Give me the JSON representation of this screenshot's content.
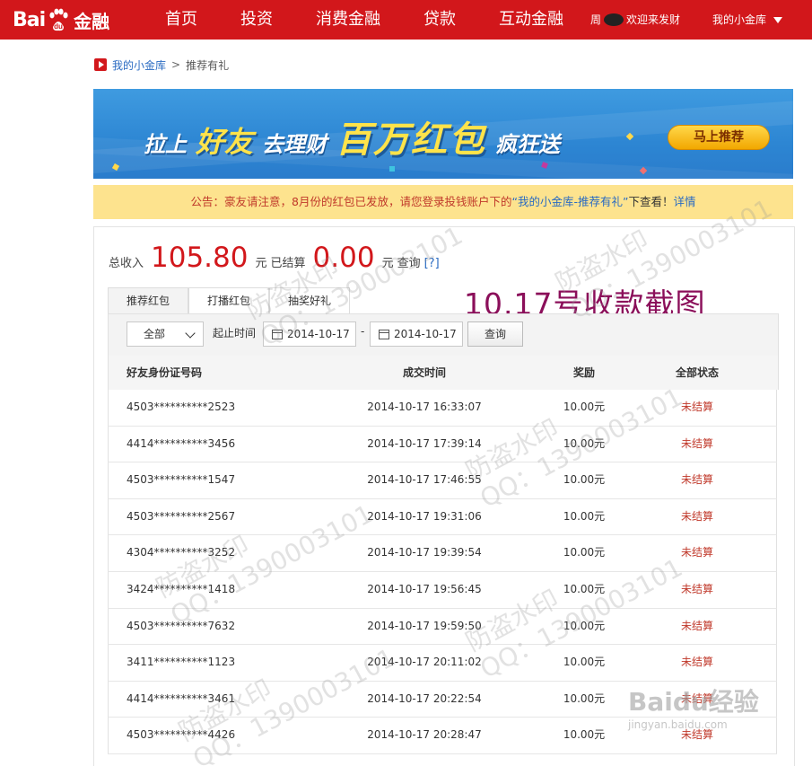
{
  "header": {
    "logo_bai": "Bai",
    "logo_du": "du",
    "logo_jr": "金融",
    "nav": [
      "首页",
      "投资",
      "消费金融",
      "贷款",
      "互动金融"
    ],
    "greeting_prefix": "周",
    "greeting_suffix": "欢迎来发财",
    "my_vault": "我的小金库"
  },
  "breadcrumb": {
    "home": "我的小金库",
    "sep": ">",
    "current": "推荐有礼"
  },
  "banner": {
    "t1": "拉上",
    "t2": "好友",
    "t3": "去理财",
    "t4": "百万红包",
    "t5": "疯狂送",
    "button": "马上推荐"
  },
  "notice": {
    "prefix": "公告：豪友请注意，8月份的红包已发放，请您登录投钱账户下的",
    "quote": "“我的小金库-推荐有礼”",
    "mid": "下查看！",
    "link": "详情"
  },
  "summary": {
    "total_label": "总收入",
    "total_value": "105.80",
    "unit1": "元",
    "settled_label": "已结算",
    "settled_value": "0.00",
    "unit2": "元",
    "query": "查询",
    "help": "[?]"
  },
  "overlay_title": "10.17号收款截图",
  "tabs": [
    "推荐红包",
    "打播红包",
    "抽奖好礼"
  ],
  "filter": {
    "select_value": "全部",
    "range_label": "起止时间",
    "start_date": "2014-10-17",
    "dash": "-",
    "end_date": "2014-10-17",
    "query_button": "查询"
  },
  "table": {
    "headers": [
      "好友身份证号码",
      "成交时间",
      "奖励",
      "全部状态"
    ],
    "rows": [
      {
        "id": "4503**********2523",
        "time": "2014-10-17 16:33:07",
        "amount": "10.00元",
        "status": "未结算"
      },
      {
        "id": "4414**********3456",
        "time": "2014-10-17 17:39:14",
        "amount": "10.00元",
        "status": "未结算"
      },
      {
        "id": "4503**********1547",
        "time": "2014-10-17 17:46:55",
        "amount": "10.00元",
        "status": "未结算"
      },
      {
        "id": "4503**********2567",
        "time": "2014-10-17 19:31:06",
        "amount": "10.00元",
        "status": "未结算"
      },
      {
        "id": "4304**********3252",
        "time": "2014-10-17 19:39:54",
        "amount": "10.00元",
        "status": "未结算"
      },
      {
        "id": "3424**********1418",
        "time": "2014-10-17 19:56:45",
        "amount": "10.00元",
        "status": "未结算"
      },
      {
        "id": "4503**********7632",
        "time": "2014-10-17 19:59:50",
        "amount": "10.00元",
        "status": "未结算"
      },
      {
        "id": "3411**********1123",
        "time": "2014-10-17 20:11:02",
        "amount": "10.00元",
        "status": "未结算"
      },
      {
        "id": "4414**********3461",
        "time": "2014-10-17 20:22:54",
        "amount": "10.00元",
        "status": "未结算"
      },
      {
        "id": "4503**********4426",
        "time": "2014-10-17 20:28:47",
        "amount": "10.00元",
        "status": "未结算"
      }
    ]
  },
  "watermark": {
    "line1": "防盗水印",
    "line2": "QQ：1390003101"
  },
  "baidu_jingyan": {
    "l1": "Baidu经验",
    "l2": "jingyan.baidu.com"
  },
  "colors": {
    "brand_red": "#d2171b",
    "link_blue": "#2a6bc2",
    "notice_bg": "#fde38e",
    "overlay_title": "#8b0f5a"
  }
}
